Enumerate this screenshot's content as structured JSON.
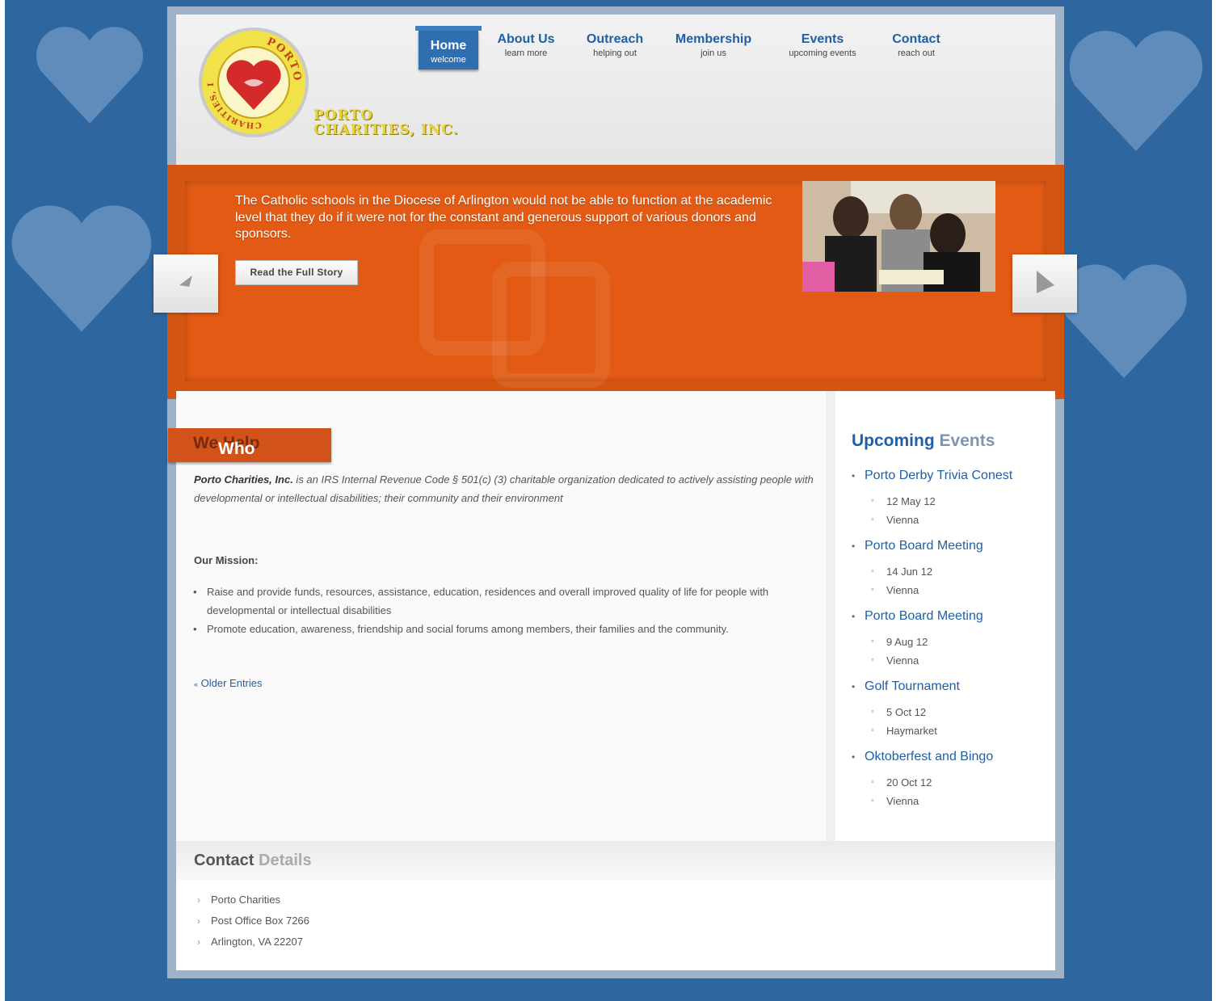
{
  "brand": {
    "logo_arc_top": "PORTO",
    "logo_arc_bottom": "CHARITIES, INC.",
    "line1": "PORTO",
    "line2": "CHARITIES, INC."
  },
  "nav": [
    {
      "title": "Home",
      "sub": "welcome",
      "active": true
    },
    {
      "title": "About Us",
      "sub": "learn more"
    },
    {
      "title": "Outreach",
      "sub": "helping out"
    },
    {
      "title": "Membership",
      "sub": "join us"
    },
    {
      "title": "Events",
      "sub": "upcoming events"
    },
    {
      "title": "Contact",
      "sub": "reach out"
    }
  ],
  "slider": {
    "text": "The Catholic schools in the Diocese of Arlington would not be able to function at the academic level that they do if it were not for the constant and generous support of various donors and sponsors.",
    "button": "Read the Full Story"
  },
  "who_we_help": {
    "title_1": "Who",
    "title_2": "We Help",
    "intro_bold": "Porto Charities, Inc.",
    "intro_rest": " is an IRS Internal Revenue Code § 501(c) (3) charitable organization dedicated to actively assisting people with developmental or intellectual disabilities; their community and their environment",
    "mission_label": "Our Mission:",
    "mission": [
      "Raise and provide funds, resources, assistance, education, residences and overall improved quality of life for people with developmental or intellectual disabilities",
      "Promote education, awareness, friendship and social forums among members, their families and the community."
    ],
    "older_icon": "«",
    "older": "Older Entries"
  },
  "events": {
    "title_1": "Upcoming",
    "title_2": "Events",
    "items": [
      {
        "name": "Porto Derby Trivia Conest",
        "date": "12 May 12",
        "place": "Vienna"
      },
      {
        "name": "Porto Board Meeting",
        "date": "14 Jun 12",
        "place": "Vienna"
      },
      {
        "name": "Porto Board Meeting",
        "date": "9 Aug 12",
        "place": "Vienna"
      },
      {
        "name": "Golf Tournament",
        "date": "5 Oct 12",
        "place": "Haymarket"
      },
      {
        "name": "Oktoberfest and Bingo",
        "date": "20 Oct 12",
        "place": "Vienna"
      }
    ]
  },
  "contact": {
    "title_1": "Contact",
    "title_2": "Details",
    "lines": [
      "Porto Charities",
      "Post Office Box 7266",
      "Arlington, VA 22207"
    ]
  },
  "icons": {
    "prev": "prev-arrow-icon",
    "next": "next-arrow-icon"
  },
  "colors": {
    "nav_active": "#2f6fb0",
    "link": "#1f5fa6",
    "slider": "#e25a13",
    "background": "#2e67a0"
  }
}
